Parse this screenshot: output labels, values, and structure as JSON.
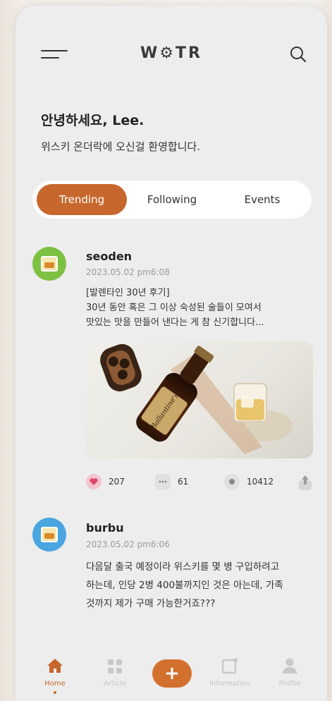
{
  "header": {
    "logo": "W⚙TR"
  },
  "greeting": {
    "title": "안녕하세요, Lee.",
    "subtitle": "위스키 온더락에 오신걸 환영합니다."
  },
  "tabs": [
    {
      "label": "Trending",
      "active": true
    },
    {
      "label": "Following",
      "active": false
    },
    {
      "label": "Events",
      "active": false
    }
  ],
  "posts": [
    {
      "username": "seoden",
      "time": "2023.05.02 pm6:08",
      "lines": [
        "[발렌타인 30년 후기]",
        "30년 동안 혹은 그 이상 숙성된 술들이 모여서",
        "맛있는 맛을 만들어 낸다는 게 참 신기합니다..."
      ],
      "likes": "207",
      "comments": "61",
      "views": "10412",
      "image_label": "Ballantine's"
    },
    {
      "username": "burbu",
      "time": "2023.05.02 pm6:06",
      "lines": [
        "다음달 출국 예정이라 위스키를 몇 병 구입하려고",
        "하는데, 인당 2병 400불까지인 것은 아는데, 가족",
        "것까지 제가 구매 가능한거죠???"
      ]
    }
  ],
  "nav": [
    {
      "label": "Home",
      "icon": "home-icon"
    },
    {
      "label": "Article",
      "icon": "grid-icon"
    },
    {
      "label": "Information",
      "icon": "info-card-icon"
    },
    {
      "label": "Profile",
      "icon": "person-icon"
    }
  ],
  "fab": {
    "label": "+"
  },
  "colors": {
    "accent": "#c8672d",
    "background": "#ededed"
  }
}
